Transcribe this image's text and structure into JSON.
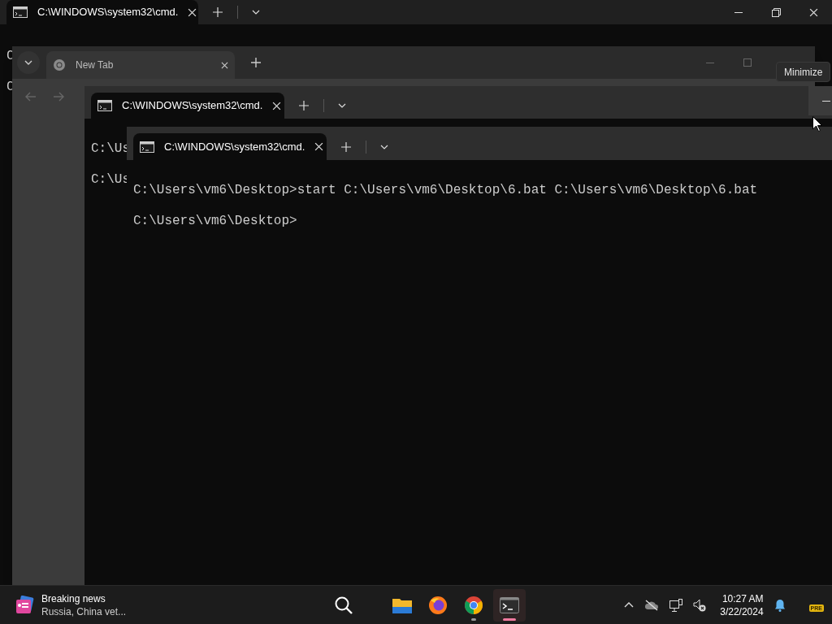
{
  "back_terminal": {
    "tabs": [
      {
        "title": "C:\\WINDOWS\\system32\\cmd.",
        "selected": true
      }
    ],
    "lines": [
      "C",
      "C"
    ]
  },
  "browser": {
    "tabs": [
      {
        "title": "New Tab",
        "selected": true
      }
    ]
  },
  "middle_terminal": {
    "tabs": [
      {
        "title": "C:\\WINDOWS\\system32\\cmd.",
        "selected": true
      }
    ],
    "lines": [
      "C:\\Us",
      "C:\\Us"
    ],
    "minimize_hovered": true
  },
  "front_terminal": {
    "tabs": [
      {
        "title": "C:\\WINDOWS\\system32\\cmd.",
        "selected": true
      }
    ],
    "lines": [
      "C:\\Users\\vm6\\Desktop>start C:\\Users\\vm6\\Desktop\\6.bat C:\\Users\\vm6\\Desktop\\6.bat",
      "C:\\Users\\vm6\\Desktop>"
    ]
  },
  "tooltip": "Minimize",
  "taskbar": {
    "news": {
      "title": "Breaking news",
      "subtitle": "Russia, China vet..."
    },
    "apps": [
      {
        "kind": "search",
        "running": false,
        "selected": false
      },
      {
        "kind": "files",
        "running": false,
        "selected": false
      },
      {
        "kind": "firefox",
        "running": false,
        "selected": false
      },
      {
        "kind": "chrome",
        "running": true,
        "selected": false
      },
      {
        "kind": "terminal",
        "running": true,
        "selected": true
      }
    ],
    "time": "10:27 AM",
    "date": "3/22/2024",
    "badge": "PRE"
  }
}
